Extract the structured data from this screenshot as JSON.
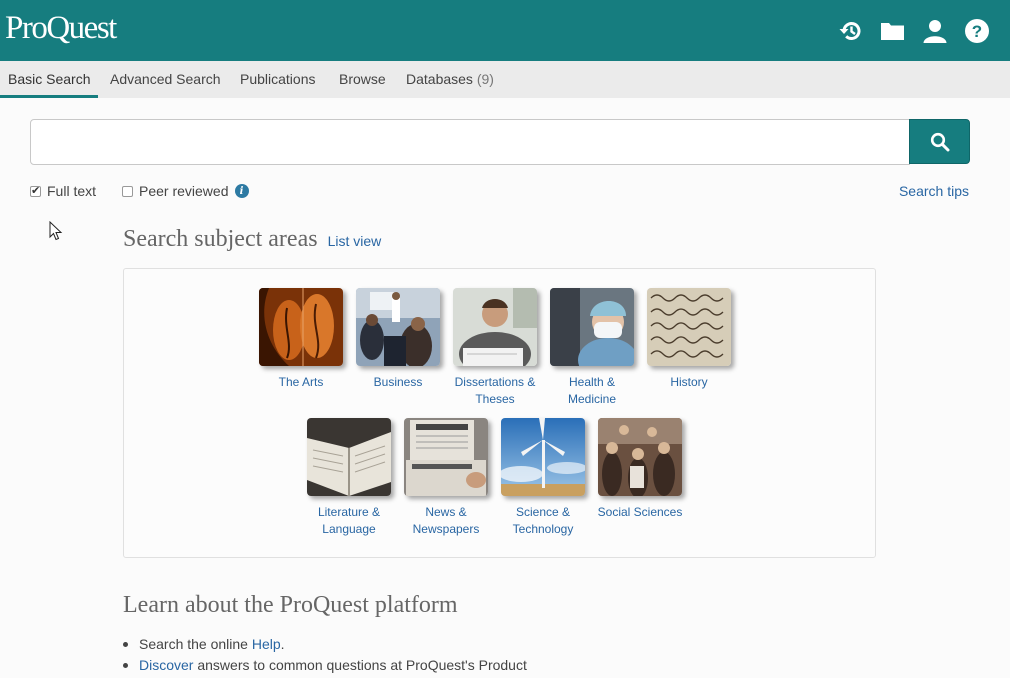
{
  "header": {
    "logo": "ProQuest",
    "icons": [
      "history-icon",
      "folder-icon",
      "user-icon",
      "help-icon"
    ]
  },
  "tabs": [
    {
      "label": "Basic Search",
      "active": true
    },
    {
      "label": "Advanced Search"
    },
    {
      "label": "Publications"
    },
    {
      "label": "Browse"
    },
    {
      "label": "Databases",
      "count": "(9)"
    }
  ],
  "search": {
    "value": "",
    "placeholder": "",
    "button_icon": "search-icon"
  },
  "filters": {
    "full_text": {
      "label": "Full text",
      "checked": true
    },
    "peer_reviewed": {
      "label": "Peer reviewed",
      "checked": false,
      "info_icon": "i"
    }
  },
  "search_tips": "Search tips",
  "subjects": {
    "title": "Search subject areas",
    "list_view": "List view",
    "items": [
      {
        "line1": "The Arts",
        "line2": ""
      },
      {
        "line1": "Business",
        "line2": ""
      },
      {
        "line1": "Dissertations &",
        "line2": "Theses"
      },
      {
        "line1": "Health &",
        "line2": "Medicine"
      },
      {
        "line1": "History",
        "line2": ""
      },
      {
        "line1": "Literature &",
        "line2": "Language"
      },
      {
        "line1": "News &",
        "line2": "Newspapers"
      },
      {
        "line1": "Science &",
        "line2": "Technology"
      },
      {
        "line1": "Social Sciences",
        "line2": ""
      }
    ]
  },
  "learn": {
    "title": "Learn about the ProQuest platform",
    "bullet1_text": "Search the online ",
    "bullet1_link": "Help",
    "bullet1_end": ".",
    "bullet2_link": "Discover",
    "bullet2_text": " answers to common questions at ProQuest's Product"
  },
  "colors": {
    "brand": "#167d7f",
    "link": "#2966a3"
  }
}
